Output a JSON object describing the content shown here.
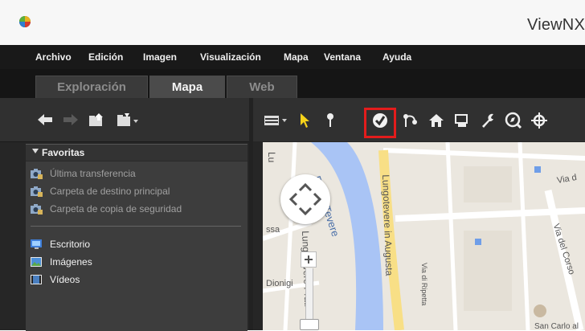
{
  "window": {
    "title": "ViewNX"
  },
  "menu": [
    "Archivo",
    "Edición",
    "Imagen",
    "Visualización",
    "Mapa",
    "Ventana",
    "Ayuda"
  ],
  "tabs": [
    {
      "label": "Exploración",
      "active": false
    },
    {
      "label": "Mapa",
      "active": true
    },
    {
      "label": "Web",
      "active": false
    }
  ],
  "favorites": {
    "title": "Favoritas",
    "items": [
      {
        "label": "Última transferencia",
        "icon": "camera-folder-icon"
      },
      {
        "label": "Carpeta de destino principal",
        "icon": "camera-folder-icon"
      },
      {
        "label": "Carpeta de copia de seguridad",
        "icon": "camera-folder-icon"
      },
      {
        "label": "Escritorio",
        "icon": "desktop-folder-icon"
      },
      {
        "label": "Imágenes",
        "icon": "pictures-folder-icon"
      },
      {
        "label": "Vídeos",
        "icon": "videos-folder-icon"
      }
    ]
  },
  "map": {
    "labels": {
      "fiume": "Fiume Tevere",
      "lungotevere": "Lungotevere in Augusta",
      "via_ripetta": "Via di Ripetta",
      "via_corso": "Via del Corso",
      "prati": "Lungotevere Prati",
      "dionigi": "Dionigi",
      "ssa": "ssa",
      "lu": "Lu",
      "via_d": "Via d",
      "san_carlo": "San Carlo al"
    }
  },
  "colors": {
    "highlight": "#e31c1c",
    "river": "#a9c4f5",
    "map_bg": "#ebe7df"
  }
}
